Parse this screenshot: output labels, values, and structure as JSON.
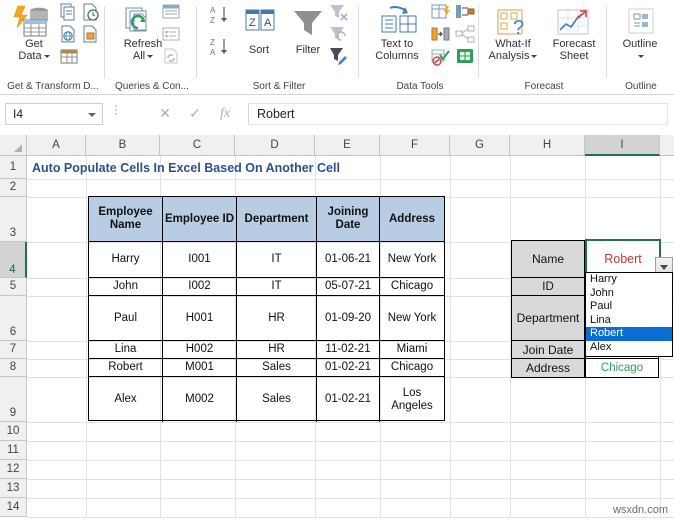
{
  "ribbon": {
    "groups": [
      {
        "label": "Get & Transform D...",
        "buttons": [
          {
            "label1": "Get",
            "label2": "Data",
            "icon": "get-data-icon",
            "has_caret": true
          }
        ]
      },
      {
        "label": "Queries & Con...",
        "buttons": [
          {
            "label1": "Refresh",
            "label2": "All",
            "icon": "refresh-all-icon",
            "has_caret": true
          }
        ]
      },
      {
        "label": "Sort & Filter",
        "buttons": [
          {
            "label1": "Sort",
            "label2": "",
            "icon": "sort-icon",
            "has_caret": false
          },
          {
            "label1": "Filter",
            "label2": "",
            "icon": "filter-icon",
            "has_caret": false
          }
        ]
      },
      {
        "label": "Data Tools",
        "buttons": [
          {
            "label1": "Text to",
            "label2": "Columns",
            "icon": "text-to-columns-icon",
            "has_caret": false
          }
        ]
      },
      {
        "label": "Forecast",
        "buttons": [
          {
            "label1": "What-If",
            "label2": "Analysis",
            "icon": "what-if-icon",
            "has_caret": true
          },
          {
            "label1": "Forecast",
            "label2": "Sheet",
            "icon": "forecast-sheet-icon",
            "has_caret": false
          }
        ]
      },
      {
        "label": "Outline",
        "buttons": [
          {
            "label1": "Outline",
            "label2": "",
            "icon": "outline-icon",
            "has_caret": true
          }
        ]
      }
    ],
    "small_icons": [
      "copy-icon",
      "recent-sources-icon",
      "from-web-icon",
      "from-table-icon",
      "existing-connections-icon",
      "queries-properties-icon",
      "workbook-connections-icon",
      "edit-links-icon",
      "sort-az-icon",
      "sort-za-icon",
      "clear-filter-icon",
      "reapply-filter-icon",
      "advanced-filter-icon",
      "flash-fill-icon",
      "remove-duplicates-icon",
      "data-validation-icon",
      "consolidate-icon",
      "relationships-icon",
      "manage-model-icon"
    ]
  },
  "formula_bar": {
    "name_box_value": "I4",
    "cancel_icon": "cancel-icon",
    "confirm_icon": "confirm-icon",
    "function_icon": "fx-icon",
    "formula_value": "Robert"
  },
  "grid": {
    "columns": [
      "A",
      "B",
      "C",
      "D",
      "E",
      "F",
      "G",
      "H",
      "I"
    ],
    "selected_column": "I",
    "rows": [
      "1",
      "2",
      "3",
      "4",
      "5",
      "6",
      "7",
      "8",
      "9",
      "10",
      "11",
      "12",
      "13",
      "14"
    ],
    "selected_row": "4",
    "title": "Auto Populate Cells In Excel Based On Another Cell"
  },
  "employee_table": {
    "headers": [
      "Employee Name",
      "Employee ID",
      "Department",
      "Joining Date",
      "Address"
    ],
    "rows": [
      [
        "Harry",
        "I001",
        "IT",
        "01-06-21",
        "New York"
      ],
      [
        "John",
        "I002",
        "IT",
        "05-07-21",
        "Chicago"
      ],
      [
        "Paul",
        "H001",
        "HR",
        "01-09-20",
        "New York"
      ],
      [
        "Lina",
        "H002",
        "HR",
        "11-02-21",
        "Miami"
      ],
      [
        "Robert",
        "M001",
        "Sales",
        "01-02-21",
        "Chicago"
      ],
      [
        "Alex",
        "M002",
        "Sales",
        "01-02-21",
        "Los Angeles"
      ]
    ]
  },
  "lookup_panel": {
    "labels": [
      "Name",
      "ID",
      "Department",
      "Join Date",
      "Address"
    ],
    "selected_name": "Robert",
    "address_value": "Chicago",
    "dropdown_icon": "chevron-down-icon",
    "dropdown_options": [
      "Harry",
      "John",
      "Paul",
      "Lina",
      "Robert",
      "Alex"
    ],
    "dropdown_active": "Robert"
  },
  "colors": {
    "accent_green": "#217346",
    "header_fill": "#b8cce4",
    "title_blue": "#2f4f8f",
    "value_red": "#c0392b",
    "value_green": "#2e9e5b",
    "highlight_blue": "#0a6cd4"
  },
  "watermark": "wsxdn.com"
}
